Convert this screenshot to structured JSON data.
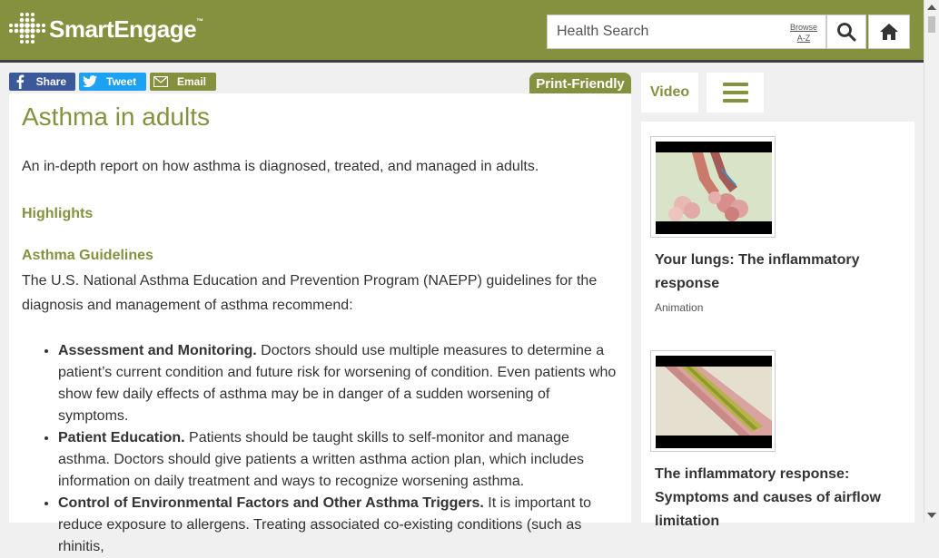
{
  "header": {
    "logo_text": "SmartEngage",
    "logo_tm": "™",
    "search_placeholder": "Health Search",
    "browse_line1": "Browse",
    "browse_line2": "A-Z"
  },
  "share": {
    "facebook": "Share",
    "twitter": "Tweet",
    "email": "Email"
  },
  "print_label": "Print-Friendly",
  "article": {
    "title": "Asthma in adults",
    "intro": "An in-depth report on how asthma is diagnosed, treated, and managed in adults.",
    "highlights_heading": "Highlights",
    "guidelines_heading": "Asthma Guidelines",
    "paragraph": "The U.S. National Asthma Education and Prevention Program (NAEPP) guidelines for the diagnosis and management of asthma recommend:",
    "list": [
      {
        "bold": "Assessment and Monitoring.",
        "text": " Doctors should use multiple measures to determine a patient’s current condition and future risk for worsening of condition. Even patients who show few daily effects of asthma may be in danger of a sudden worsening of symptoms."
      },
      {
        "bold": "Patient Education.",
        "text": " Patients should be taught skills to self-monitor and manage asthma. Doctors should give patients a written asthma action plan, which includes information on daily treatment and ways to recognize worsening asthma."
      },
      {
        "bold": "Control of Environmental Factors and Other Asthma Triggers.",
        "text": " It is important to reduce exposure to allergens. Treating associated co-existing conditions (such as rhinitis,"
      }
    ]
  },
  "sidebar": {
    "tab_video": "Video",
    "videos": [
      {
        "title": "Your lungs: The inflammatory response",
        "type": "Animation"
      },
      {
        "title": "The inflammatory response: Symptoms and causes of airflow limitation",
        "type": ""
      }
    ]
  },
  "colors": {
    "brand": "#869140",
    "facebook": "#3b5998",
    "twitter": "#1da1f2"
  }
}
